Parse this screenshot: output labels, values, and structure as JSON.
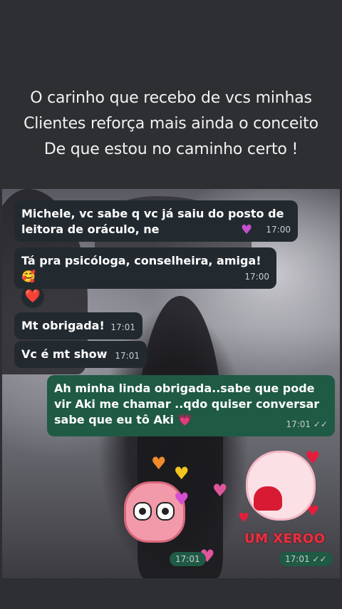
{
  "caption": {
    "lines": [
      "O carinho que recebo de vcs minhas",
      "Clientes reforça mais ainda o conceito",
      "De que estou no caminho certo !"
    ]
  },
  "messages": [
    {
      "direction": "incoming",
      "lines": [
        "Michele, vc sabe q vc já saiu do posto de",
        "leitora de oráculo, ne"
      ],
      "time": "17:00"
    },
    {
      "direction": "incoming",
      "lines": [
        "Tá pra psicóloga, conselheira, amiga!🥰"
      ],
      "time": "17:00"
    },
    {
      "direction": "incoming",
      "reaction": "❤️"
    },
    {
      "direction": "incoming",
      "lines": [
        "Mt obrigada!"
      ],
      "time": "17:01"
    },
    {
      "direction": "incoming",
      "lines": [
        "Vc é mt show"
      ],
      "time": "17:01"
    },
    {
      "direction": "outgoing",
      "lines": [
        "Ah minha linda obrigada..sabe que pode",
        "vir Aki me chamar ..qdo quiser conversar",
        "sabe que eu tô Aki 💗"
      ],
      "time": "17:01 ✓✓"
    }
  ],
  "stickers": [
    {
      "name": "pink-blob-sticker",
      "time": "17:01"
    },
    {
      "name": "pig-heart-sticker",
      "time": "17:01 ✓✓",
      "stamp_text": "UM XEROO"
    }
  ],
  "colors": {
    "background": "#2d2f33",
    "incoming_bubble": "#232a2f",
    "outgoing_bubble": "#1f5a44",
    "heart_red": "#e01e3c"
  }
}
